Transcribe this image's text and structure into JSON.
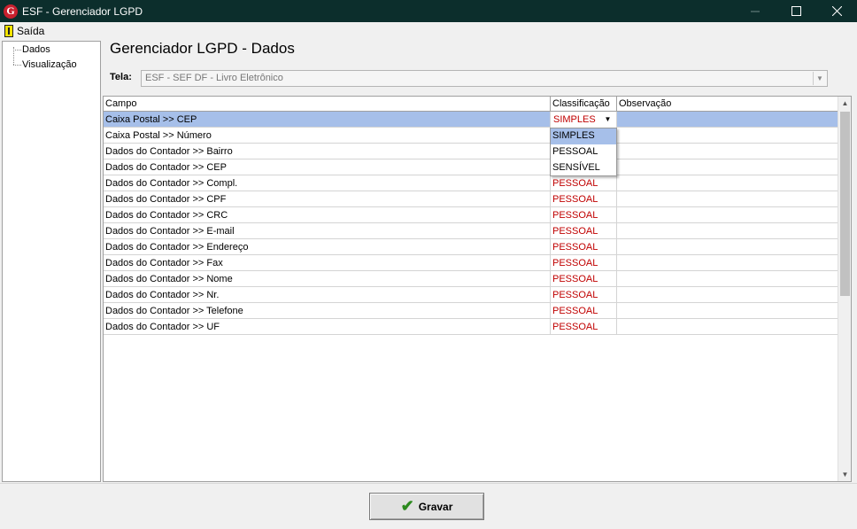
{
  "window": {
    "title": "ESF - Gerenciador LGPD",
    "app_icon": "G",
    "controls": [
      "minimize-icon",
      "maximize-icon",
      "close-icon"
    ]
  },
  "menu": {
    "exit_label": "Saída"
  },
  "tree": {
    "items": [
      {
        "label": "Dados"
      },
      {
        "label": "Visualização"
      }
    ]
  },
  "page": {
    "title": "Gerenciador LGPD - Dados",
    "tela_label": "Tela:",
    "tela_value": "ESF - SEF DF - Livro Eletrônico"
  },
  "grid": {
    "columns": [
      "Campo",
      "Classificação",
      "Observação"
    ],
    "rows": [
      {
        "campo": "Caixa Postal >> CEP",
        "classificacao": "SIMPLES",
        "observacao": "",
        "selected": true
      },
      {
        "campo": "Caixa Postal >> Número",
        "classificacao": "",
        "observacao": ""
      },
      {
        "campo": "Dados do Contador >> Bairro",
        "classificacao": "",
        "observacao": ""
      },
      {
        "campo": "Dados do Contador >> CEP",
        "classificacao": "",
        "observacao": ""
      },
      {
        "campo": "Dados do Contador >> Compl.",
        "classificacao": "PESSOAL",
        "observacao": ""
      },
      {
        "campo": "Dados do Contador >> CPF",
        "classificacao": "PESSOAL",
        "observacao": ""
      },
      {
        "campo": "Dados do Contador >> CRC",
        "classificacao": "PESSOAL",
        "observacao": ""
      },
      {
        "campo": "Dados do Contador >> E-mail",
        "classificacao": "PESSOAL",
        "observacao": ""
      },
      {
        "campo": "Dados do Contador >> Endereço",
        "classificacao": "PESSOAL",
        "observacao": ""
      },
      {
        "campo": "Dados do Contador >> Fax",
        "classificacao": "PESSOAL",
        "observacao": ""
      },
      {
        "campo": "Dados do Contador >> Nome",
        "classificacao": "PESSOAL",
        "observacao": ""
      },
      {
        "campo": "Dados do Contador >> Nr.",
        "classificacao": "PESSOAL",
        "observacao": ""
      },
      {
        "campo": "Dados do Contador >> Telefone",
        "classificacao": "PESSOAL",
        "observacao": ""
      },
      {
        "campo": "Dados do Contador >> UF",
        "classificacao": "PESSOAL",
        "observacao": ""
      }
    ],
    "dropdown_options": [
      "SIMPLES",
      "PESSOAL",
      "SENSÍVEL"
    ],
    "dropdown_highlighted": "SIMPLES"
  },
  "footer": {
    "save_label": "Gravar"
  },
  "colors": {
    "titlebar": "#0c2e2c",
    "selection": "#a6bfe9",
    "classification_text": "#c00000",
    "save_check": "#2c8a1e"
  }
}
